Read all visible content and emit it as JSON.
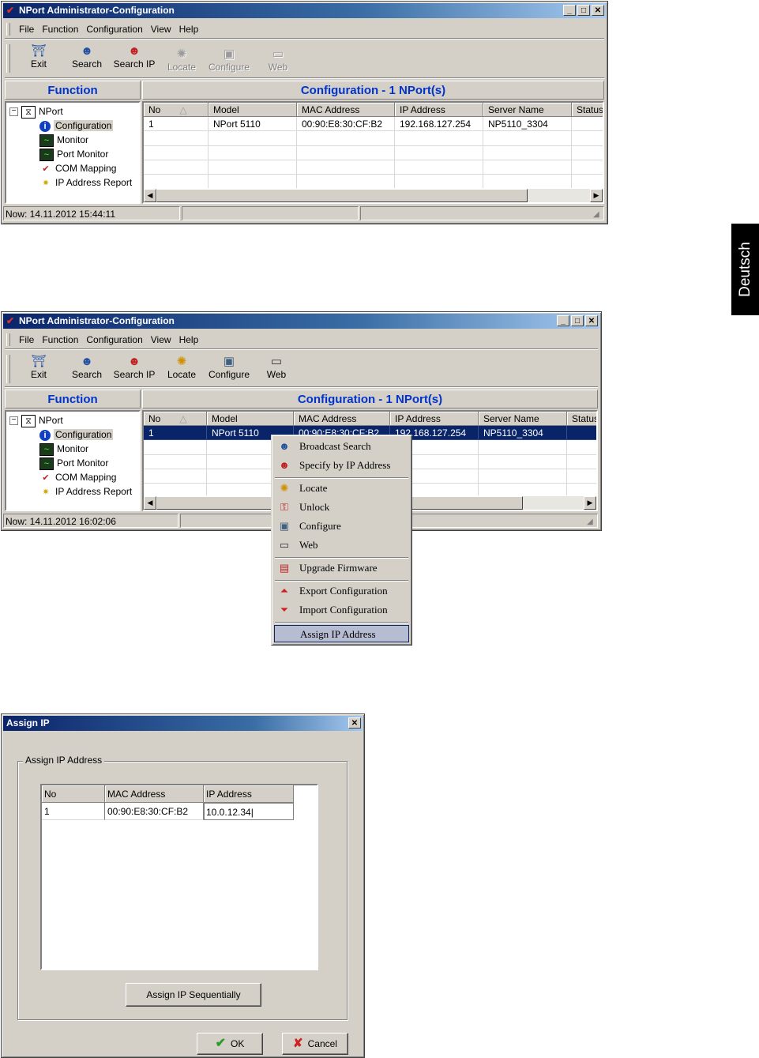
{
  "side_tab": "Deutsch",
  "window1": {
    "title": "NPort Administrator-Configuration",
    "menu": [
      "File",
      "Function",
      "Configuration",
      "View",
      "Help"
    ],
    "toolbar": [
      {
        "label": "Exit",
        "icon": "exit-icon",
        "enabled": true
      },
      {
        "label": "Search",
        "icon": "search-icon",
        "enabled": true
      },
      {
        "label": "Search IP",
        "icon": "search-ip-icon",
        "enabled": true
      },
      {
        "label": "Locate",
        "icon": "locate-icon",
        "enabled": false
      },
      {
        "label": "Configure",
        "icon": "configure-icon",
        "enabled": false
      },
      {
        "label": "Web",
        "icon": "web-icon",
        "enabled": false
      }
    ],
    "function_header": "Function",
    "config_header": "Configuration - 1 NPort(s)",
    "tree": {
      "root": "NPort",
      "items": [
        "Configuration",
        "Monitor",
        "Port Monitor",
        "COM Mapping",
        "IP Address Report"
      ]
    },
    "columns": [
      "No",
      "Model",
      "MAC Address",
      "IP Address",
      "Server Name",
      "Status"
    ],
    "rows": [
      [
        "1",
        "NPort 5110",
        "00:90:E8:30:CF:B2",
        "192.168.127.254",
        "NP5110_3304",
        ""
      ]
    ],
    "status": "Now: 14.11.2012 15:44:11"
  },
  "window2": {
    "title": "NPort Administrator-Configuration",
    "menu": [
      "File",
      "Function",
      "Configuration",
      "View",
      "Help"
    ],
    "toolbar": [
      {
        "label": "Exit",
        "icon": "exit-icon",
        "enabled": true
      },
      {
        "label": "Search",
        "icon": "search-icon",
        "enabled": true
      },
      {
        "label": "Search IP",
        "icon": "search-ip-icon",
        "enabled": true
      },
      {
        "label": "Locate",
        "icon": "locate-icon",
        "enabled": true
      },
      {
        "label": "Configure",
        "icon": "configure-icon",
        "enabled": true
      },
      {
        "label": "Web",
        "icon": "web-icon",
        "enabled": true
      }
    ],
    "function_header": "Function",
    "config_header": "Configuration - 1 NPort(s)",
    "tree": {
      "root": "NPort",
      "items": [
        "Configuration",
        "Monitor",
        "Port Monitor",
        "COM Mapping",
        "IP Address Report"
      ]
    },
    "columns": [
      "No",
      "Model",
      "MAC Address",
      "IP Address",
      "Server Name",
      "Status"
    ],
    "rows": [
      [
        "1",
        "NPort 5110",
        "00:90:E8:30:CF:B2",
        "192.168.127.254",
        "NP5110_3304",
        ""
      ]
    ],
    "status": "Now: 14.11.2012 16:02:06",
    "context_menu": [
      {
        "label": "Broadcast Search",
        "icon": "broadcast-search-icon"
      },
      {
        "label": "Specify by IP Address",
        "icon": "specify-ip-icon"
      },
      {
        "label": "Locate",
        "icon": "locate-icon"
      },
      {
        "label": "Unlock",
        "icon": "unlock-icon"
      },
      {
        "label": "Configure",
        "icon": "configure-icon"
      },
      {
        "label": "Web",
        "icon": "web-icon"
      },
      {
        "label": "Upgrade Firmware",
        "icon": "upgrade-firmware-icon"
      },
      {
        "label": "Export Configuration",
        "icon": "export-icon"
      },
      {
        "label": "Import Configuration",
        "icon": "import-icon"
      },
      {
        "label": "Assign IP Address",
        "icon": ""
      }
    ]
  },
  "dialog": {
    "title": "Assign IP",
    "group_label": "Assign IP Address",
    "columns": [
      "No",
      "MAC Address",
      "IP Address"
    ],
    "rows": [
      [
        "1",
        "00:90:E8:30:CF:B2",
        "10.0.12.34"
      ]
    ],
    "sequential_button": "Assign IP Sequentially",
    "ok_button": "OK",
    "cancel_button": "Cancel"
  },
  "colors": {
    "title_start": "#0a246a",
    "title_end": "#a6caf0",
    "header_text": "#0033cc",
    "selection": "#0a246a",
    "ok_check": "#2e9a2e",
    "cancel_x": "#d02020"
  }
}
